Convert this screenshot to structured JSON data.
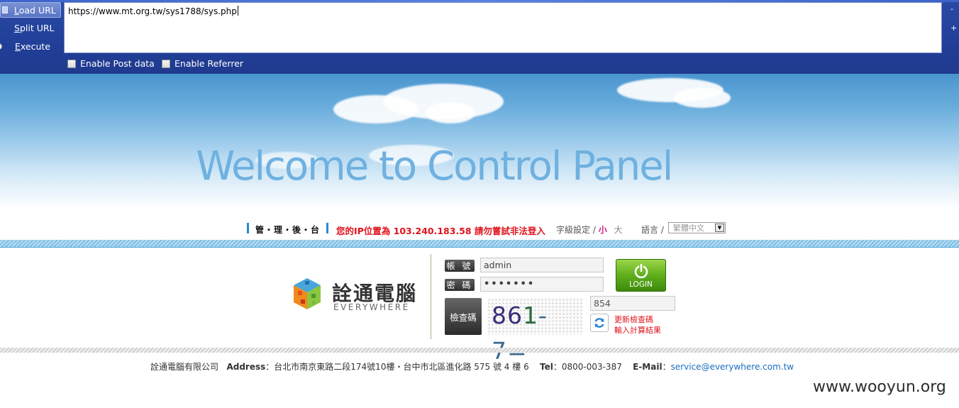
{
  "hackbar": {
    "load_url": "Load URL",
    "split_url": "Split URL",
    "execute": "Execute",
    "url_value": "https://www.mt.org.tw/sys1788/sys.php",
    "enable_post": "Enable Post data",
    "enable_referrer": "Enable Referrer",
    "minus": "-",
    "plus": "+"
  },
  "banner": {
    "title": "Welcome to Control Panel"
  },
  "infobar": {
    "admin_label": "管・理・後・台",
    "ip_warning": "您的IP位置為 103.240.183.58 請勿嘗試非法登入",
    "font_setting": "字級設定 /",
    "font_small": "小",
    "font_large": "大",
    "language": "語言 /",
    "language_value": "繁體中文"
  },
  "brand": {
    "name": "詮通電腦",
    "sub": "EVERYWHERE"
  },
  "login": {
    "user_tag": "帳 號",
    "user_value": "admin",
    "pass_tag": "密 碼",
    "pass_value": "•••••••",
    "code_tag": "檢查碼",
    "captcha_a": "86",
    "captcha_b": "1",
    "captcha_c": "- 7=",
    "captcha_answer": "854",
    "button": "LOGIN",
    "refresh_line1": "更新檢查碼",
    "refresh_line2": "輸入計算結果"
  },
  "footer": {
    "company": "詮通電腦有限公司",
    "address_label": "Address",
    "address": "：台北市南京東路二段174號10樓・台中市北區進化路 575 號 4 樓 6",
    "tel_label": "Tel",
    "tel": "：0800-003-387",
    "email_label": "E-Mail",
    "email_sep": "：",
    "email": "service@everywhere.com.tw"
  },
  "watermark": "www.wooyun.org",
  "colors": {
    "hackbar_bg": "#213f98",
    "warning_red": "#e0121a",
    "title_blue": "#6fb1e0",
    "login_green": "#5fae1c"
  }
}
